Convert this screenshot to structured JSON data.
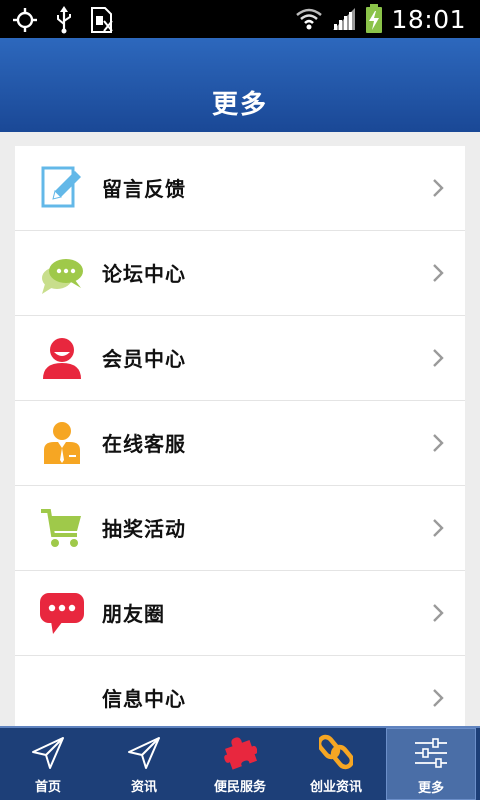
{
  "status_bar": {
    "time": "18:01",
    "icons": [
      "gps-icon",
      "usb-icon",
      "sim-icon",
      "wifi-icon",
      "signal-icon",
      "battery-charging-icon"
    ]
  },
  "header": {
    "title": "更多"
  },
  "menu": {
    "items": [
      {
        "label": "留言反馈",
        "icon": "feedback-edit-icon",
        "color": "#63b8e8"
      },
      {
        "label": "论坛中心",
        "icon": "chat-bubbles-icon",
        "color": "#9fc94a"
      },
      {
        "label": "会员中心",
        "icon": "member-user-icon",
        "color": "#e8273e"
      },
      {
        "label": "在线客服",
        "icon": "customer-service-icon",
        "color": "#f6a623"
      },
      {
        "label": "抽奖活动",
        "icon": "shopping-cart-icon",
        "color": "#9fc94a"
      },
      {
        "label": "朋友圈",
        "icon": "message-bubble-icon",
        "color": "#e8273e"
      },
      {
        "label": "信息中心",
        "icon": "",
        "color": ""
      }
    ]
  },
  "bottom_nav": {
    "items": [
      {
        "label": "首页",
        "icon": "send-arrow-icon",
        "active": false
      },
      {
        "label": "资讯",
        "icon": "send-arrow-icon",
        "active": false
      },
      {
        "label": "便民服务",
        "icon": "puzzle-icon",
        "active": false
      },
      {
        "label": "创业资讯",
        "icon": "chain-link-icon",
        "active": false
      },
      {
        "label": "更多",
        "icon": "sliders-icon",
        "active": true
      }
    ]
  },
  "colors": {
    "header_top": "#2d68bd",
    "header_bottom": "#1a4896",
    "nav_bg": "#1d3f78",
    "nav_active": "#4a6ea7"
  }
}
